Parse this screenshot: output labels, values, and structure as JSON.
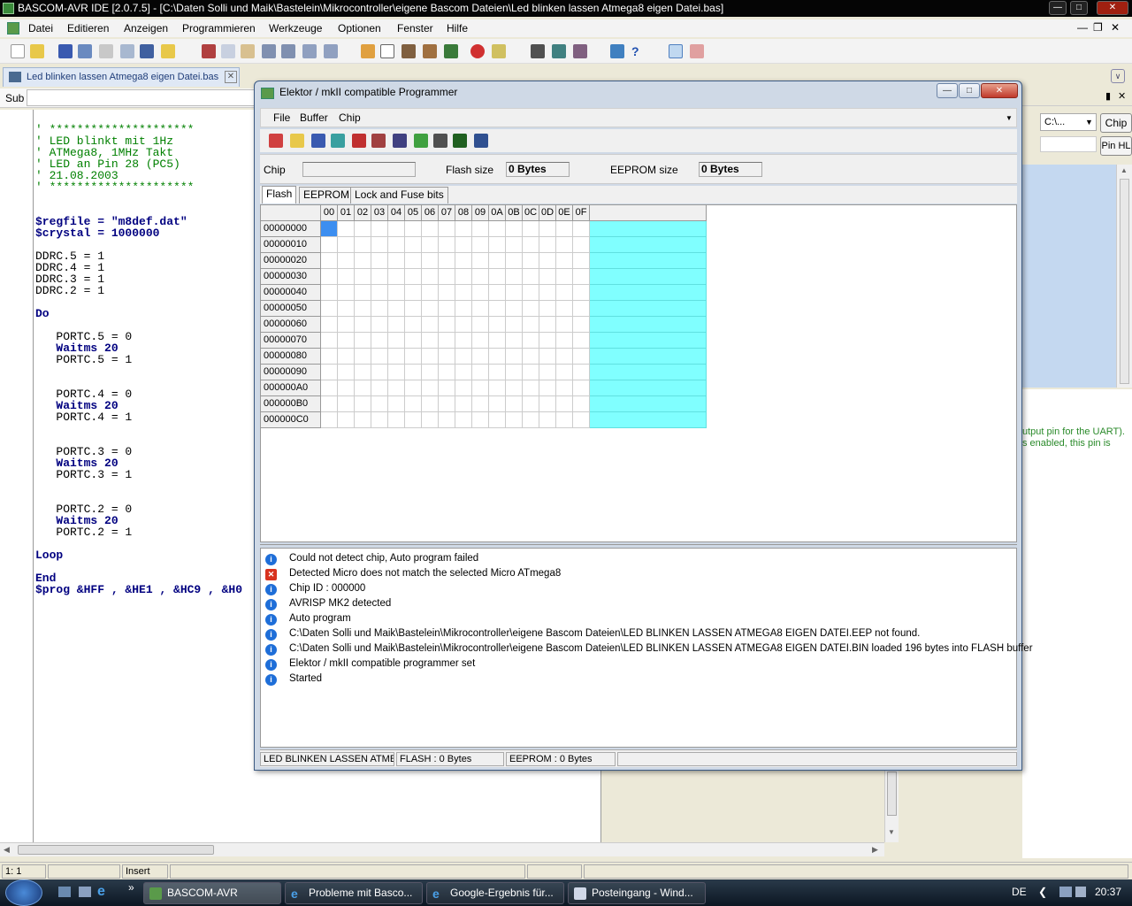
{
  "window": {
    "title": "BASCOM-AVR IDE [2.0.7.5] - [C:\\Daten Solli und Maik\\Bastelein\\Mikrocontroller\\eigene Bascom Dateien\\Led blinken lassen Atmega8 eigen Datei.bas]"
  },
  "menu": [
    "Datei",
    "Editieren",
    "Anzeigen",
    "Programmieren",
    "Werkzeuge",
    "Optionen",
    "Fenster",
    "Hilfe"
  ],
  "doc_tab": "Led blinken lassen Atmega8 eigen Datei.bas",
  "sub_label": "Sub",
  "code": [
    {
      "t": "' *********************",
      "c": "cm"
    },
    {
      "t": "' LED blinkt mit 1Hz",
      "c": "cm"
    },
    {
      "t": "' ATMega8, 1MHz Takt",
      "c": "cm"
    },
    {
      "t": "' LED an Pin 28 (PC5)",
      "c": "cm"
    },
    {
      "t": "' 21.08.2003",
      "c": "cm"
    },
    {
      "t": "' *********************",
      "c": "cm"
    },
    {
      "t": "",
      "c": ""
    },
    {
      "t": "",
      "c": ""
    },
    {
      "t": "$regfile = \"m8def.dat\"",
      "c": "kw"
    },
    {
      "t": "$crystal = 1000000",
      "c": "kw"
    },
    {
      "t": "",
      "c": ""
    },
    {
      "t": "DDRC.5 = 1",
      "c": "num"
    },
    {
      "t": "DDRC.4 = 1",
      "c": "num"
    },
    {
      "t": "DDRC.3 = 1",
      "c": "num"
    },
    {
      "t": "DDRC.2 = 1",
      "c": "num"
    },
    {
      "t": "",
      "c": ""
    },
    {
      "t": "Do",
      "c": "kw"
    },
    {
      "t": "",
      "c": ""
    },
    {
      "t": "   PORTC.5 = 0",
      "c": "num"
    },
    {
      "t": "   Waitms 20",
      "c": "kw"
    },
    {
      "t": "   PORTC.5 = 1",
      "c": "num"
    },
    {
      "t": "",
      "c": ""
    },
    {
      "t": "",
      "c": ""
    },
    {
      "t": "   PORTC.4 = 0",
      "c": "num"
    },
    {
      "t": "   Waitms 20",
      "c": "kw"
    },
    {
      "t": "   PORTC.4 = 1",
      "c": "num"
    },
    {
      "t": "",
      "c": ""
    },
    {
      "t": "",
      "c": ""
    },
    {
      "t": "   PORTC.3 = 0",
      "c": "num"
    },
    {
      "t": "   Waitms 20",
      "c": "kw"
    },
    {
      "t": "   PORTC.3 = 1",
      "c": "num"
    },
    {
      "t": "",
      "c": ""
    },
    {
      "t": "",
      "c": ""
    },
    {
      "t": "   PORTC.2 = 0",
      "c": "num"
    },
    {
      "t": "   Waitms 20",
      "c": "kw"
    },
    {
      "t": "   PORTC.2 = 1",
      "c": "num"
    },
    {
      "t": "",
      "c": ""
    },
    {
      "t": "Loop",
      "c": "kw"
    },
    {
      "t": "",
      "c": ""
    },
    {
      "t": "End",
      "c": "kw"
    },
    {
      "t": "$prog &HFF , &HE1 , &HC9 , &H0",
      "c": "kw"
    }
  ],
  "right_panel": {
    "path_combo": "C:\\...",
    "chip_button": "Chip",
    "pinhl_button": "Pin HL",
    "help_line1": "utput pin for the UART).",
    "help_line2": "s enabled, this pin is"
  },
  "statusbar": {
    "position": "1: 1",
    "mode": "Insert"
  },
  "taskbar": {
    "tasks": [
      "BASCOM-AVR",
      "Probleme mit Basco...",
      "Google-Ergebnis für...",
      "Posteingang - Wind..."
    ],
    "lang": "DE",
    "clock": "20:37"
  },
  "programmer": {
    "title": "Elektor / mkII compatible Programmer",
    "menu": [
      "File",
      "Buffer",
      "Chip"
    ],
    "chip_label": "Chip",
    "chip_value": "",
    "flash_size_label": "Flash size",
    "flash_size_value": "0 Bytes",
    "eeprom_size_label": "EEPROM size",
    "eeprom_size_value": "0 Bytes",
    "tabs": [
      "Flash",
      "EEPROM",
      "Lock and Fuse bits"
    ],
    "col_headers": [
      "00",
      "01",
      "02",
      "03",
      "04",
      "05",
      "06",
      "07",
      "08",
      "09",
      "0A",
      "0B",
      "0C",
      "0D",
      "0E",
      "0F"
    ],
    "row_addresses": [
      "00000000",
      "00000010",
      "00000020",
      "00000030",
      "00000040",
      "00000050",
      "00000060",
      "00000070",
      "00000080",
      "00000090",
      "000000A0",
      "000000B0",
      "000000C0"
    ],
    "log": [
      {
        "type": "info",
        "text": "Could not detect chip, Auto program failed"
      },
      {
        "type": "error",
        "text": "Detected Micro  does not match the selected Micro ATmega8"
      },
      {
        "type": "info",
        "text": "Chip ID : 000000"
      },
      {
        "type": "info",
        "text": "AVRISP MK2 detected"
      },
      {
        "type": "info",
        "text": "Auto program"
      },
      {
        "type": "info",
        "text": "C:\\Daten Solli und Maik\\Bastelein\\Mikrocontroller\\eigene Bascom Dateien\\LED BLINKEN LASSEN ATMEGA8 EIGEN DATEI.EEP not found."
      },
      {
        "type": "info",
        "text": "C:\\Daten Solli und Maik\\Bastelein\\Mikrocontroller\\eigene Bascom Dateien\\LED BLINKEN LASSEN ATMEGA8 EIGEN DATEI.BIN loaded 196 bytes into FLASH buffer"
      },
      {
        "type": "info",
        "text": "Elektor / mkII compatible programmer set"
      },
      {
        "type": "info",
        "text": "Started"
      }
    ],
    "status": {
      "file": "LED BLINKEN LASSEN ATME",
      "flash": "FLASH : 0 Bytes",
      "eeprom": "EEPROM : 0 Bytes"
    }
  }
}
